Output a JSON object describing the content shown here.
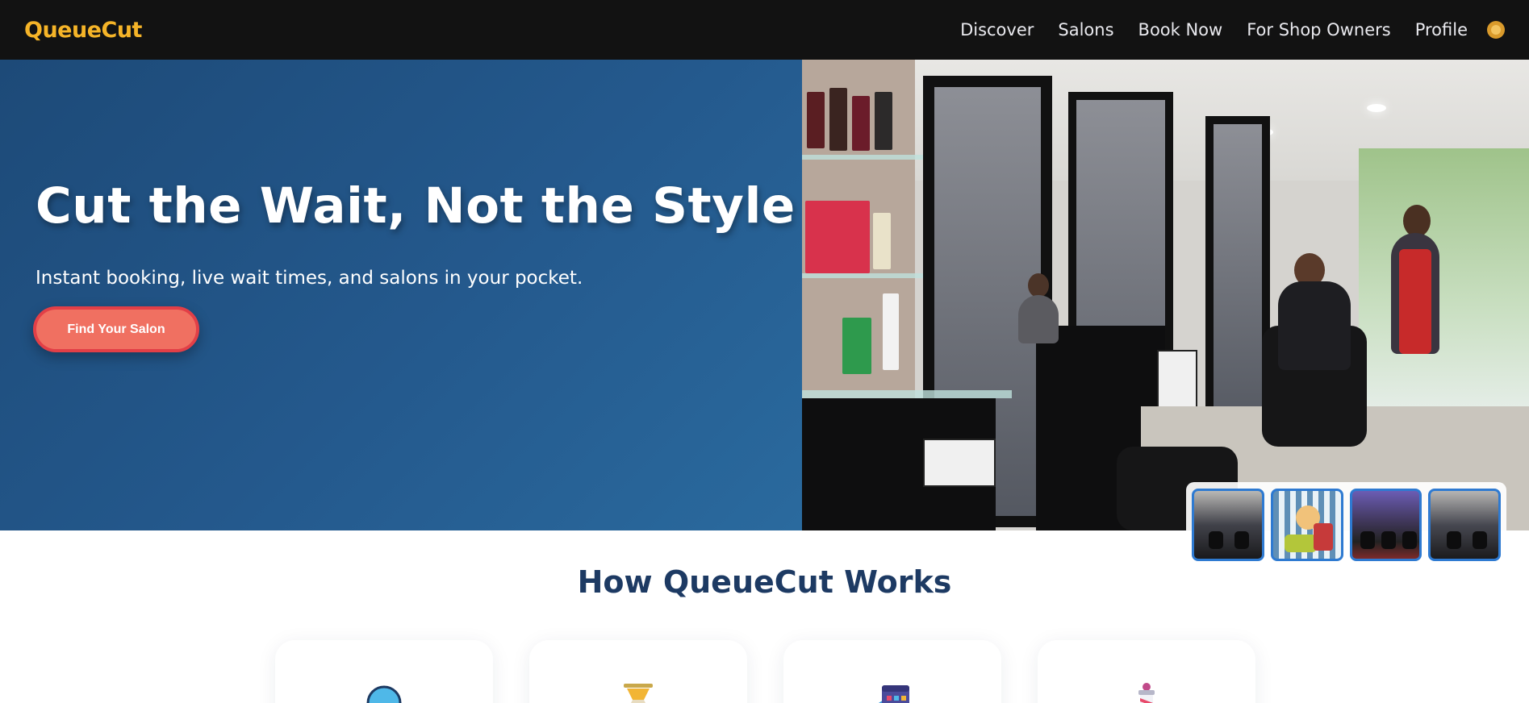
{
  "nav": {
    "brand": "QueueCut",
    "links": [
      "Discover",
      "Salons",
      "Book Now",
      "For Shop Owners",
      "Profile"
    ]
  },
  "hero": {
    "title": "Cut the Wait, Not the Style",
    "subtitle": "Instant booking, live wait times, and salons in your pocket.",
    "cta_label": "Find Your Salon"
  },
  "gallery": {
    "thumbnail_count": 4,
    "selected_index": 0
  },
  "how": {
    "title": "How QueueCut Works",
    "cards": [
      {
        "icon": "magnifying-glass-icon"
      },
      {
        "icon": "hourglass-icon"
      },
      {
        "icon": "calendar-icon"
      },
      {
        "icon": "barber-pole-icon"
      }
    ]
  },
  "colors": {
    "brand": "#f5b428",
    "nav_bg": "#121212",
    "hero_bg": "#24598d",
    "cta": "#f07061",
    "heading": "#1d3a63",
    "thumb_border": "#2e7ad1"
  }
}
